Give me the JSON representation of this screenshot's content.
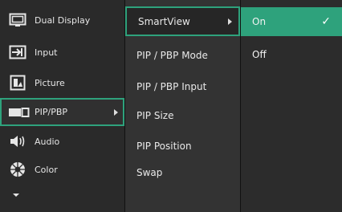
{
  "main_menu": {
    "items": [
      {
        "label": "Dual Display",
        "icon": "dual-display-icon"
      },
      {
        "label": "Input",
        "icon": "input-icon"
      },
      {
        "label": "Picture",
        "icon": "picture-icon"
      },
      {
        "label": "PIP/PBP",
        "icon": "pip-pbp-icon",
        "selected": true
      },
      {
        "label": "Audio",
        "icon": "speaker-icon"
      },
      {
        "label": "Color",
        "icon": "color-icon"
      }
    ],
    "more_icon": "chevron-down-icon"
  },
  "sub_menu": {
    "items": [
      {
        "label": "SmartView",
        "selected": true
      },
      {
        "label": "PIP / PBP Mode"
      },
      {
        "label": "PIP / PBP Input"
      },
      {
        "label": "PIP Size"
      },
      {
        "label": "PIP Position"
      },
      {
        "label": "Swap"
      }
    ]
  },
  "options": {
    "items": [
      {
        "label": "On",
        "selected": true,
        "check": "✓"
      },
      {
        "label": "Off"
      }
    ]
  },
  "colors": {
    "accent": "#2ea27c",
    "panel_bg": "#2a2a2a"
  }
}
